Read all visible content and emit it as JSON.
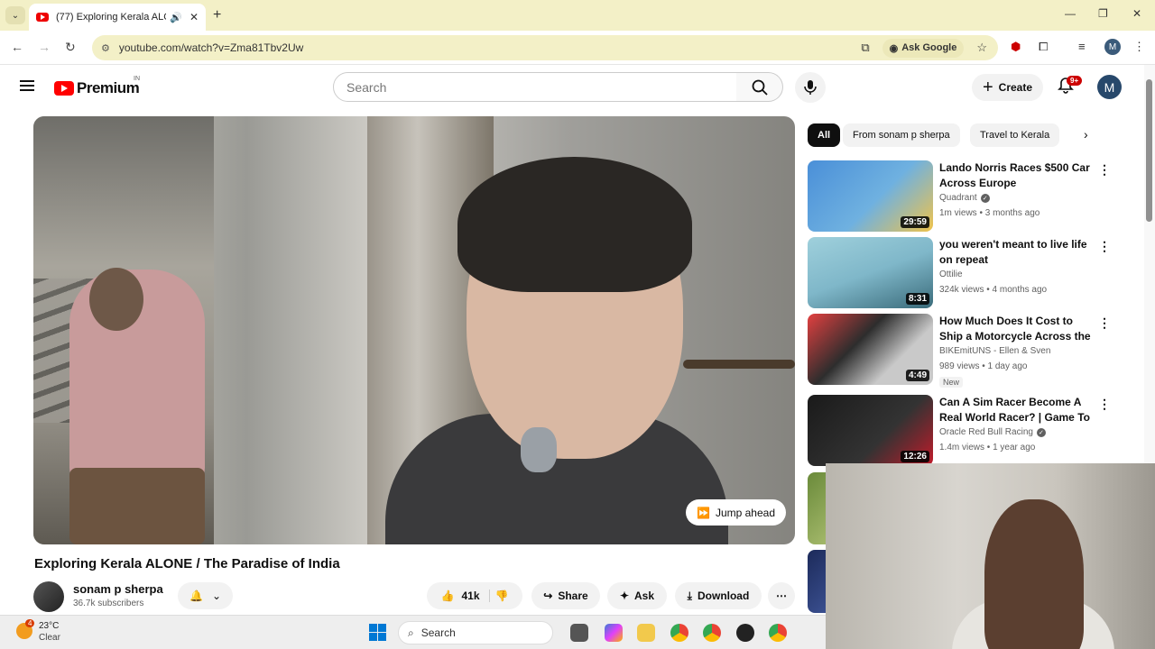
{
  "browser": {
    "tab_title": "(77) Exploring Kerala ALONE",
    "url": "youtube.com/watch?v=Zma81Tbv2Uw",
    "ask_google": "Ask Google",
    "profile_initial": "M"
  },
  "header": {
    "logo_text": "Premium",
    "country": "IN",
    "search_placeholder": "Search",
    "create_label": "Create",
    "notification_count": "9+",
    "avatar_initial": "M"
  },
  "player": {
    "jump_ahead_label": "Jump ahead"
  },
  "video": {
    "title": "Exploring Kerala ALONE / The Paradise of India",
    "channel": "sonam p sherpa",
    "subscribers": "36.7k subscribers",
    "likes": "41k",
    "share_label": "Share",
    "ask_label": "Ask",
    "download_label": "Download"
  },
  "chips": [
    "All",
    "From sonam p sherpa",
    "Travel to Kerala"
  ],
  "recommendations": [
    {
      "title": "Lando Norris Races $500 Car Across Europe",
      "channel": "Quadrant",
      "verified": true,
      "meta": "1m views • 3 months ago",
      "duration": "29:59",
      "badge": "",
      "thumb_colors": [
        "#4a8fd8",
        "#6fb1e0",
        "#f0c34a"
      ]
    },
    {
      "title": "you weren't meant to live life on repeat",
      "channel": "Ottilie",
      "verified": false,
      "meta": "324k views • 4 months ago",
      "duration": "8:31",
      "badge": "",
      "thumb_colors": [
        "#7fb7c9",
        "#9fd0dc",
        "#3a6b7a"
      ]
    },
    {
      "title": "How Much Does It Cost to Ship a Motorcycle Across the Darié…",
      "channel": "BIKEmitUNS - Ellen & Sven",
      "verified": false,
      "meta": "989 views • 1 day ago",
      "duration": "4:49",
      "badge": "New",
      "thumb_colors": [
        "#c9c9c9",
        "#e34040",
        "#2d2d2d"
      ]
    },
    {
      "title": "Can A Sim Racer Become A Real World Racer? | Game To …",
      "channel": "Oracle Red Bull Racing",
      "verified": true,
      "meta": "1.4m views • 1 year ago",
      "duration": "12:26",
      "badge": "",
      "thumb_colors": [
        "#1a1a1a",
        "#333333",
        "#c21b2a"
      ]
    }
  ],
  "taskbar": {
    "weather_badge": "4",
    "temperature": "23°C",
    "condition": "Clear",
    "search_label": "Search"
  },
  "icons": {
    "audio": "🔊",
    "bell": "🔔",
    "like": "👍",
    "dislike": "👎",
    "share": "↪",
    "ask": "✦",
    "download": "⤓",
    "more": "⋯",
    "verified": "✓"
  }
}
